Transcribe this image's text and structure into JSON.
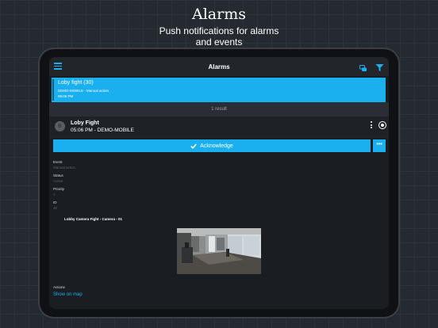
{
  "promo": {
    "title": "Alarms",
    "subtitle_line1": "Push notifications for alarms",
    "subtitle_line2": "and events"
  },
  "app": {
    "title": "Alarms",
    "icons": {
      "menu": "hamburger-menu-icon",
      "chat": "chat-bubbles-icon",
      "filter": "filter-funnel-icon"
    },
    "accent_color": "#1ab0f0"
  },
  "alarm_list": {
    "items": [
      {
        "title": "Loby fight (30)",
        "meta": "DEMO-MOBILE - Manual action",
        "time": "05:06 PM"
      }
    ],
    "result_count": "1 result"
  },
  "detail": {
    "avatar_letter": "B",
    "title": "Loby Fight",
    "subtitle": "05:06 PM - DEMO-MOBILE",
    "acknowledge_label": "Acknowledge",
    "more_label": "•••",
    "fields": [
      {
        "label": "Event",
        "value": "Manual action"
      },
      {
        "label": "Status",
        "value": "Active"
      },
      {
        "label": "Priority",
        "value": "1"
      },
      {
        "label": "ID",
        "value": "30"
      }
    ],
    "camera_title": "Lobby Camera Fight - Camera - 01",
    "actions_label": "Actions",
    "show_on_map": "Show on map"
  }
}
